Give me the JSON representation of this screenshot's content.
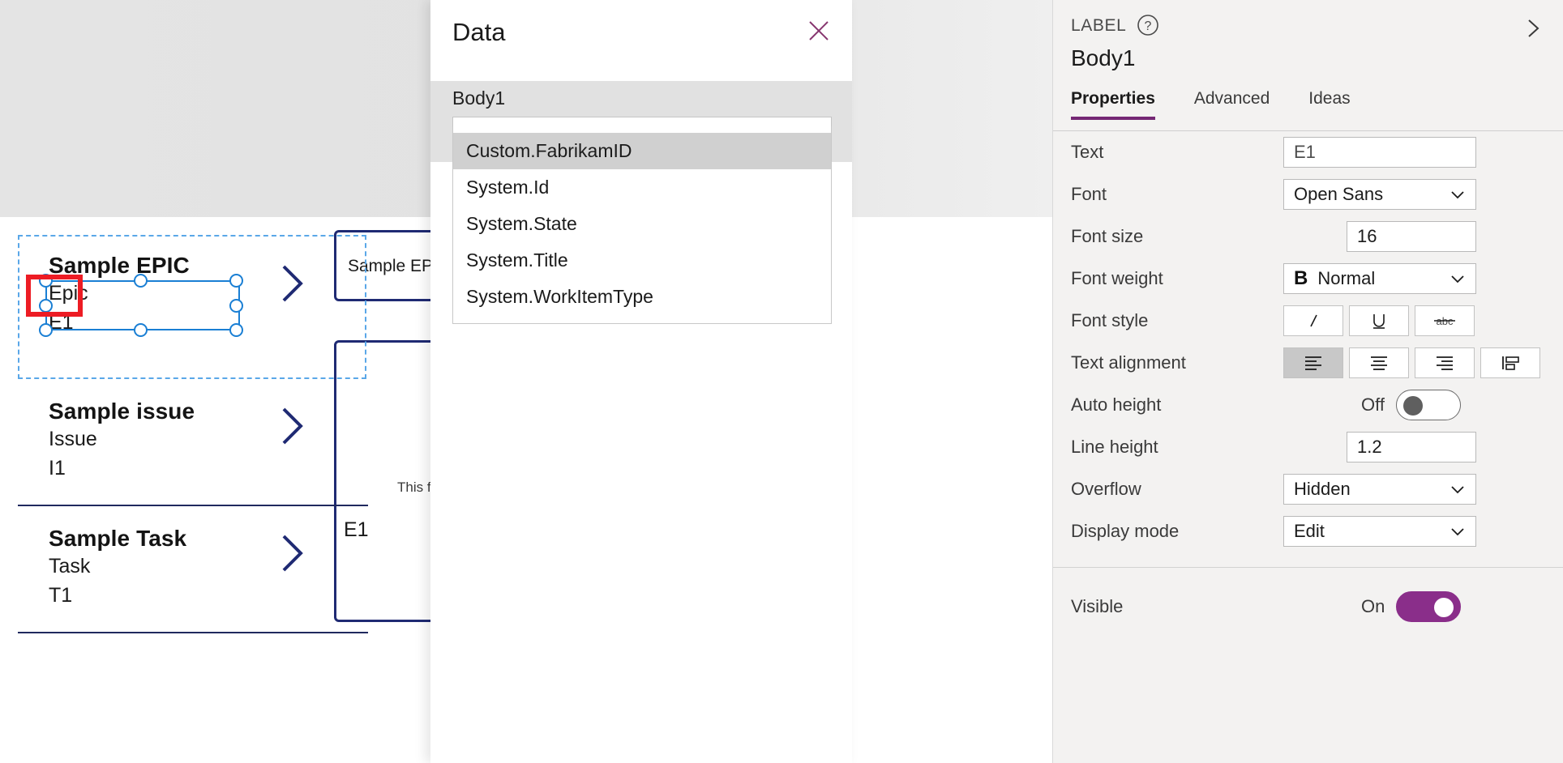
{
  "canvas": {
    "gallery": [
      {
        "title": "Sample EPIC",
        "type": "Epic",
        "id": "E1",
        "chevron_icon": "chevron-right-icon"
      },
      {
        "title": "Sample issue",
        "type": "Issue",
        "id": "I1",
        "chevron_icon": "chevron-right-icon"
      },
      {
        "title": "Sample Task",
        "type": "Task",
        "id": "T1",
        "chevron_icon": "chevron-right-icon"
      }
    ],
    "detail": {
      "card_title": "Sample EPIC",
      "note": "This fo",
      "id": "E1"
    }
  },
  "data_panel": {
    "title": "Data",
    "close_icon": "close-icon",
    "field_group_label": "Body1",
    "selected_value": "Custom.FabrikamID",
    "dropdown_icon": "chevron-down-icon",
    "options": [
      {
        "label": "Custom.FabrikamID",
        "selected": true
      },
      {
        "label": "System.Id",
        "selected": false
      },
      {
        "label": "System.State",
        "selected": false
      },
      {
        "label": "System.Title",
        "selected": false
      },
      {
        "label": "System.WorkItemType",
        "selected": false
      }
    ]
  },
  "properties_panel": {
    "kicker": "LABEL",
    "help_icon": "help-circle-icon",
    "expand_icon": "chevron-right-icon",
    "control_name": "Body1",
    "tabs": [
      {
        "label": "Properties",
        "active": true
      },
      {
        "label": "Advanced",
        "active": false
      },
      {
        "label": "Ideas",
        "active": false
      }
    ],
    "rows": {
      "text": {
        "label": "Text",
        "value": "E1"
      },
      "font": {
        "label": "Font",
        "value": "Open Sans",
        "icon": "chevron-down-icon"
      },
      "font_size": {
        "label": "Font size",
        "value": "16"
      },
      "font_weight": {
        "label": "Font weight",
        "value": "Normal",
        "prefix_icon": "bold-icon",
        "icon": "chevron-down-icon"
      },
      "font_style": {
        "label": "Font style",
        "options": [
          {
            "icon": "italic-icon",
            "on": false
          },
          {
            "icon": "underline-icon",
            "on": false
          },
          {
            "icon": "strikethrough-icon",
            "on": false
          }
        ]
      },
      "text_alignment": {
        "label": "Text alignment",
        "options": [
          {
            "icon": "align-left-icon",
            "on": true
          },
          {
            "icon": "align-center-icon",
            "on": false
          },
          {
            "icon": "align-right-icon",
            "on": false
          },
          {
            "icon": "align-justify-icon",
            "on": false
          }
        ]
      },
      "auto_height": {
        "label": "Auto height",
        "state": "Off",
        "on": false
      },
      "line_height": {
        "label": "Line height",
        "value": "1.2"
      },
      "overflow": {
        "label": "Overflow",
        "value": "Hidden",
        "icon": "chevron-down-icon"
      },
      "display_mode": {
        "label": "Display mode",
        "value": "Edit",
        "icon": "chevron-down-icon"
      },
      "visible": {
        "label": "Visible",
        "state": "On",
        "on": true
      }
    }
  },
  "colors": {
    "accent_purple": "#742774",
    "toggle_on": "#8a2e8a",
    "annotation_red": "#ed1c24",
    "selection_blue": "#1a7fd4",
    "card_navy": "#1f2a73"
  }
}
